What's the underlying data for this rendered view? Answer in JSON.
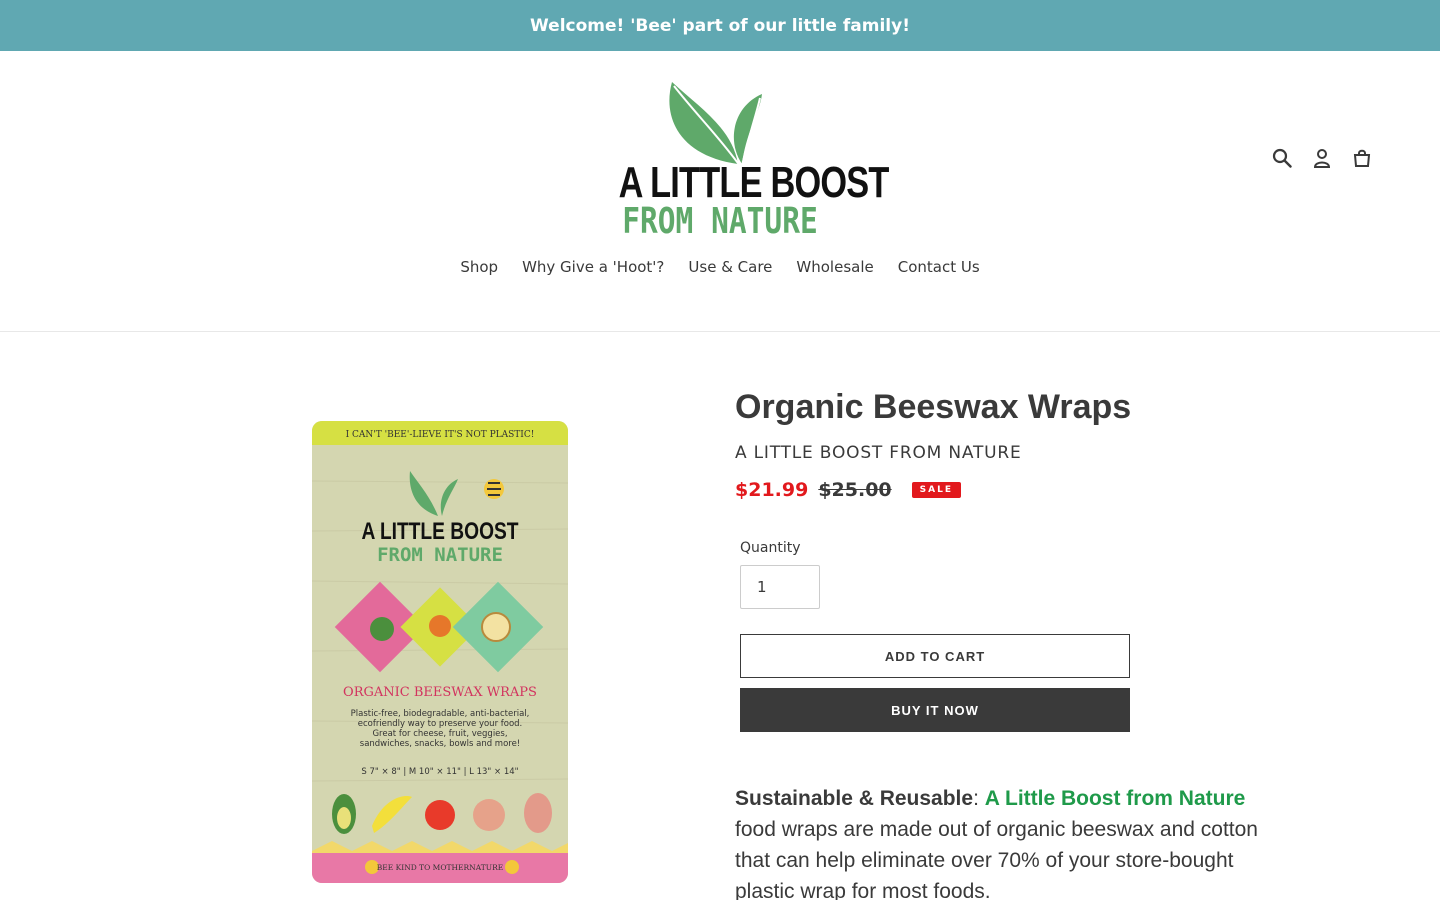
{
  "announcement": {
    "text": "Welcome! 'Bee' part of our little family!"
  },
  "logo": {
    "line1": "A LITTLE BOOST",
    "line2": "FROM NATURE"
  },
  "header_icons": [
    "search-icon",
    "account-icon",
    "cart-icon"
  ],
  "nav": [
    {
      "label": "Shop"
    },
    {
      "label": "Why Give a 'Hoot'?"
    },
    {
      "label": "Use & Care"
    },
    {
      "label": "Wholesale"
    },
    {
      "label": "Contact Us"
    }
  ],
  "product": {
    "title": "Organic Beeswax Wraps",
    "vendor": "A LITTLE BOOST FROM NATURE",
    "price_sale": "$21.99",
    "price_compare": "$25.00",
    "sale_badge": "SALE",
    "quantity_label": "Quantity",
    "quantity_value": "1",
    "add_to_cart": "ADD TO CART",
    "buy_now": "BUY IT NOW",
    "description": {
      "heading": "Sustainable & Reusable",
      "colon": ":",
      "brand_link": "A Little Boost from Nature",
      "body": "food wraps are made out of organic beeswax and cotton that can help eliminate over 70% of your store-bought plastic wrap for most foods."
    }
  },
  "package": {
    "top_banner": "I CAN'T 'BEE'-LIEVE IT'S NOT PLASTIC!",
    "brand_line1": "A LITTLE BOOST",
    "brand_line2": "FROM NATURE",
    "product_name": "ORGANIC BEESWAX WRAPS",
    "tagline1": "Plastic-free, biodegradable, anti-bacterial,",
    "tagline2": "ecofriendly way to preserve your food.",
    "tagline3": "Great for cheese, fruit, veggies,",
    "tagline4": "sandwiches, snacks, bowls and more!",
    "sizes": "S 7\" × 8\" | M 10\" × 11\" | L 13\" × 14\"",
    "bottom_banner": "BEE KIND TO MOTHERNATURE"
  },
  "colors": {
    "announcement_bg": "#60a8b2",
    "sale_red": "#e2191d",
    "brand_green": "#5fa96a",
    "link_green": "#1f9a4a",
    "text_dark": "#3a3a3a"
  }
}
